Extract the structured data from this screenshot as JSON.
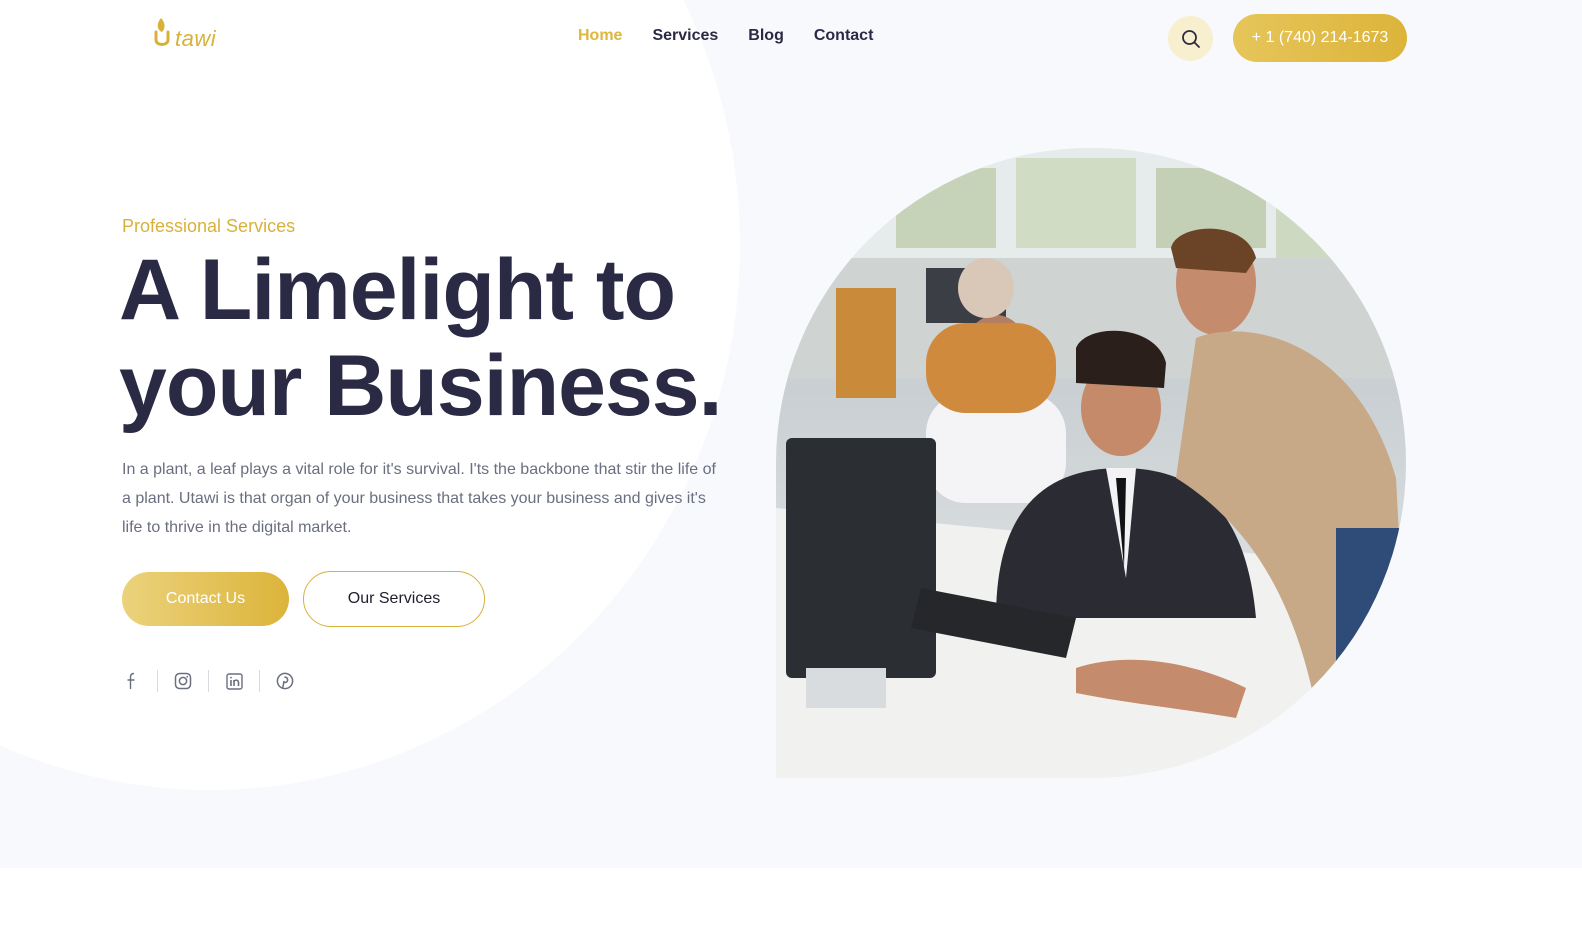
{
  "header": {
    "logo_text": "tawi",
    "nav": [
      {
        "label": "Home",
        "active": true
      },
      {
        "label": "Services",
        "active": false
      },
      {
        "label": "Blog",
        "active": false
      },
      {
        "label": "Contact",
        "active": false
      }
    ],
    "search_icon": "search-icon",
    "phone": "+ 1 (740) 214-1673"
  },
  "hero": {
    "eyebrow": "Professional Services",
    "headline_line1": "A Limelight to",
    "headline_line2": "your Business.",
    "description": "In a plant, a leaf plays a vital role for it's survival. I'ts the backbone that stir the life of a plant. Utawi is that organ of your business that takes your business and gives it's life to thrive in the digital market.",
    "primary_button": "Contact Us",
    "secondary_button": "Our Services",
    "socials": [
      "facebook-icon",
      "instagram-icon",
      "linkedin-icon",
      "pinterest-icon"
    ],
    "photo": "office-team-photo"
  },
  "colors": {
    "accent": "#dfb53c",
    "heading": "#2b2a45",
    "body_text": "#6a6f80",
    "background": "#f8f9fc"
  }
}
